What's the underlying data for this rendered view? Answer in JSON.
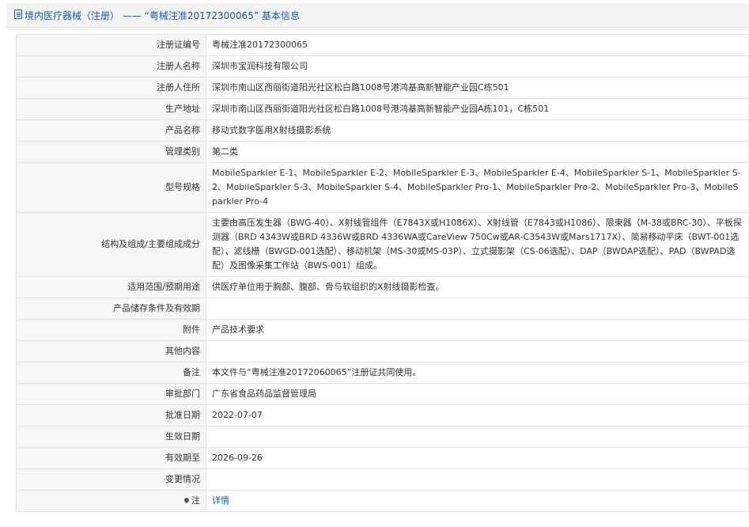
{
  "header": {
    "title": "境内医疗器械（注册） —— “粤械注准20172300065” 基本信息",
    "icon": "document-icon"
  },
  "colors": {
    "accent": "#1a5aa6",
    "label_bg": "#f6f6f6",
    "border": "#e3e3e3"
  },
  "fields": [
    {
      "label": "注册证编号",
      "value": "粤械注准20172300065"
    },
    {
      "label": "注册人名称",
      "value": "深圳市宝润科技有限公司"
    },
    {
      "label": "注册人住所",
      "value": "深圳市南山区西丽街道阳光社区松白路1008号港鸿基高新智能产业园C栋501"
    },
    {
      "label": "生产地址",
      "value": "深圳市南山区西丽街道阳光社区松白路1008号港鸿基高新智能产业园A栋101，C栋501"
    },
    {
      "label": "产品名称",
      "value": "移动式数字医用X射线摄影系统"
    },
    {
      "label": "管理类别",
      "value": "第二类"
    },
    {
      "label": "型号规格",
      "value": "MobileSparkler E-1、MobileSparkler E-2、MobileSparkler E-3、MobileSparkler E-4、MobileSparkler S-1、MobileSparkler S-2、MobileSparkler S-3、MobileSparkler S-4、MobileSparkler Pro-1、MobileSparkler Pro-2、MobileSparkler Pro-3、MobileSparkler Pro-4"
    },
    {
      "label": "结构及组成/主要组成成分",
      "value": "主要由高压发生器（BWG-40）、X射线管组件（E7843X或H1086X）、X射线管（E7843或H1086）、限束器（M-38或BRC-30）、平板探测器（BRD 4343W或BRD 4336W或BRD 4336WA或CareView 750Cw或AR-C3543W或Mars1717X）、简易移动平床（BWT-001选配）、滤线栅（BWGD-001选配）、移动机架（MS-30或MS-03P）、立式摄影架（CS-06选配）、DAP（BWDAP选配）、PAD（BWPAD选配）及图像采集工作站（BWS-001）组成。"
    },
    {
      "label": "适用范围/预期用途",
      "value": "供医疗单位用于胸部、腹部、骨与软组织的X射线摄影检查。"
    },
    {
      "label": "产品储存条件及有效期",
      "value": ""
    },
    {
      "label": "附件",
      "value": "产品技术要求"
    },
    {
      "label": "其他内容",
      "value": ""
    },
    {
      "label": "备注",
      "value": "本文件与“粤械注准20172060065”注册证共同使用。"
    },
    {
      "label": "审批部门",
      "value": "广东省食品药品监督管理局"
    },
    {
      "label": "批准日期",
      "value": "2022-07-07"
    },
    {
      "label": "生效日期",
      "value": ""
    },
    {
      "label": "有效期至",
      "value": "2026-09-26"
    },
    {
      "label": "变更情况",
      "value": ""
    }
  ],
  "note": {
    "label": "注",
    "icon": "location-pin-icon",
    "link_text": "详情"
  }
}
